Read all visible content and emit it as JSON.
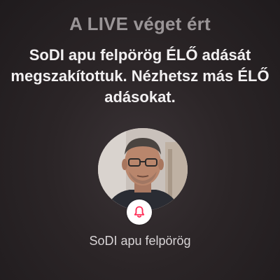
{
  "live_ended": {
    "title": "A LIVE véget ért",
    "message_lines": [
      "SoDI apu felpörög ÉLŐ adását",
      "megszakítottuk. Nézhetsz más ÉLŐ",
      "adásokat."
    ]
  },
  "host": {
    "username": "SoDI apu felpörög",
    "avatar_icon": "profile-photo",
    "notify_icon": "bell-icon"
  },
  "colors": {
    "background": "#2b2527",
    "title": "#9a9597",
    "message": "#f2f0f1",
    "bell_accent": "#fe2c55"
  }
}
